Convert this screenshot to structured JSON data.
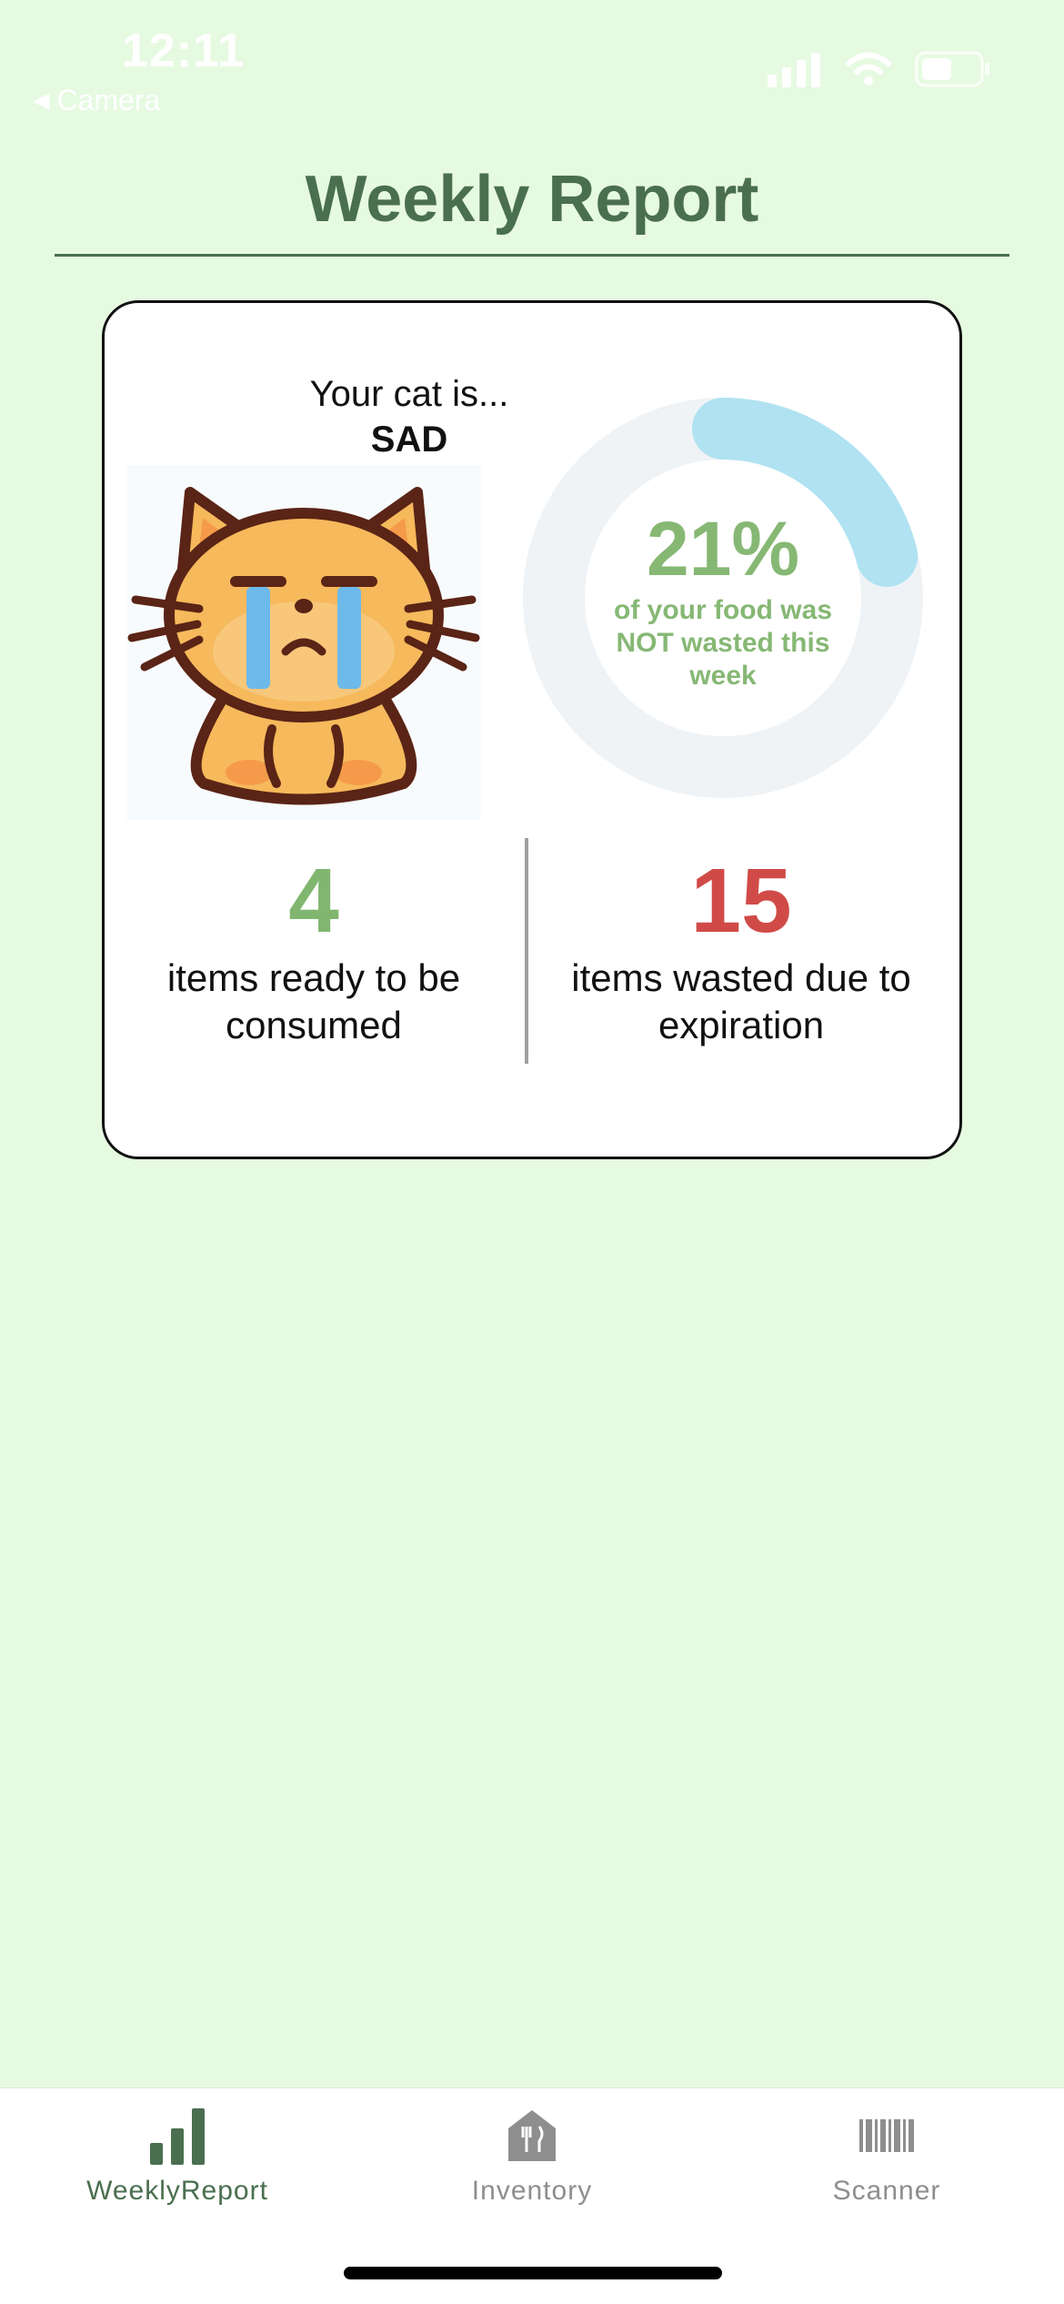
{
  "status_bar": {
    "time": "12:11",
    "back_label": "Camera",
    "icons": [
      "signal-icon",
      "wifi-icon",
      "battery-icon"
    ]
  },
  "header": {
    "title": "Weekly Report"
  },
  "report": {
    "cat_caption": "Your cat is...",
    "cat_mood": "SAD",
    "cat_icon": "sad-cat-image",
    "not_wasted_percent": "21%",
    "not_wasted_fraction": 0.21,
    "not_wasted_label": "of your food was NOT wasted this week",
    "ready_count": "4",
    "ready_label": "items ready to be consumed",
    "wasted_count": "15",
    "wasted_label": "items wasted due to expiration"
  },
  "tabs": [
    {
      "label": "WeeklyReport",
      "icon": "bar-chart-icon",
      "active": true
    },
    {
      "label": "Inventory",
      "icon": "fridge-utensils-icon",
      "active": false
    },
    {
      "label": "Scanner",
      "icon": "barcode-icon",
      "active": false
    }
  ],
  "colors": {
    "background": "#e6fae1",
    "primary": "#4a6f4f",
    "positive": "#80b670",
    "negative": "#d04b48",
    "donut_fill": "#b0e2f2",
    "donut_track": "#eff3f6"
  }
}
